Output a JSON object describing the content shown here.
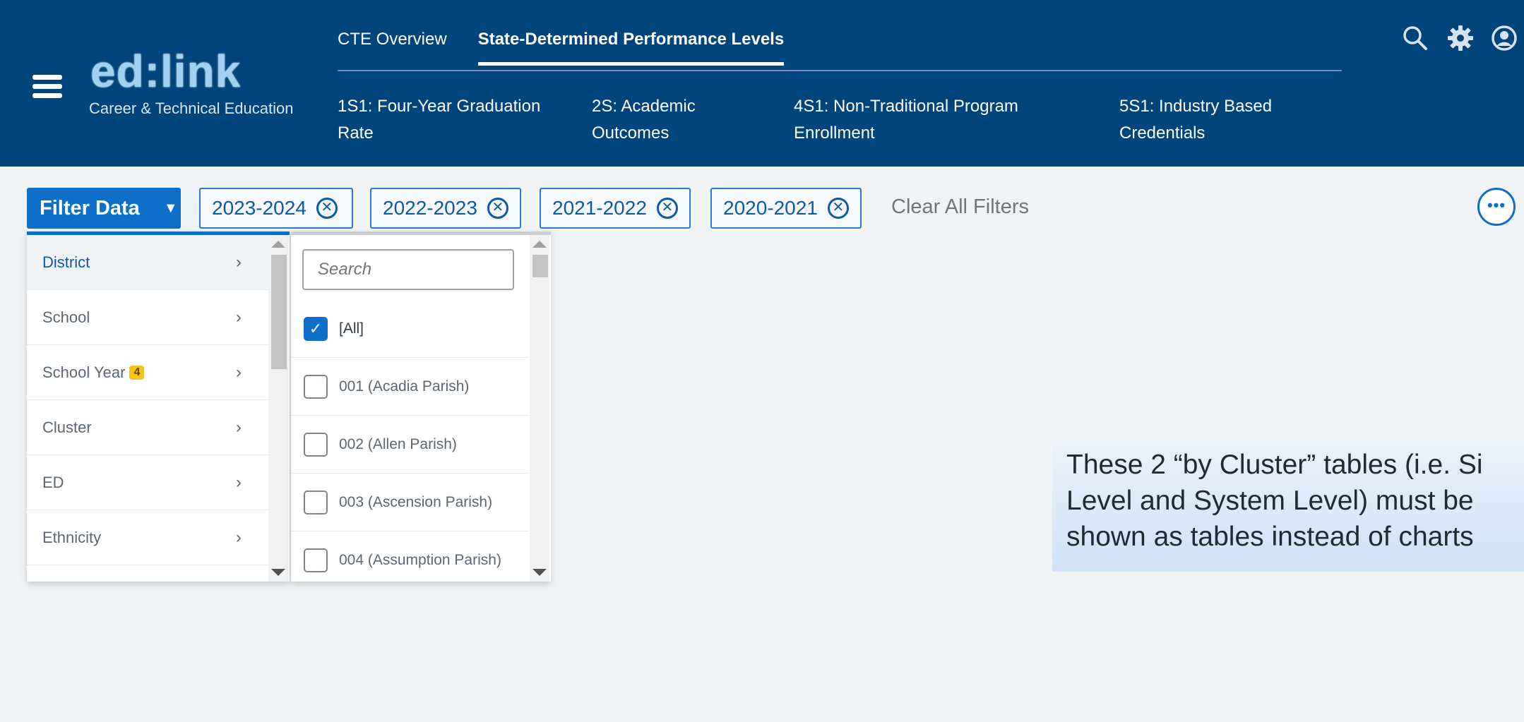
{
  "app": {
    "logo_text": "ed:link",
    "subtitle": "Career & Technical Education"
  },
  "nav": {
    "tabs": [
      {
        "label": "CTE Overview",
        "active": false
      },
      {
        "label": "State-Determined Performance Levels",
        "active": true
      }
    ],
    "subtabs": [
      {
        "line1": "1S1: Four-Year Graduation",
        "line2": "Rate"
      },
      {
        "line1": "2S: Academic",
        "line2": "Outcomes"
      },
      {
        "line1": "4S1: Non-Traditional Program",
        "line2": "Enrollment"
      },
      {
        "line1": "5S1: Industry Based",
        "line2": "Credentials"
      }
    ]
  },
  "header_icons": [
    "search-icon",
    "gear-icon",
    "account-icon"
  ],
  "toolbar": {
    "filter_label": "Filter Data",
    "chips": [
      "2023-2024",
      "2022-2023",
      "2021-2022",
      "2020-2021"
    ],
    "clear_label": "Clear All Filters",
    "more_label": "•••"
  },
  "filter_panel": {
    "categories": [
      {
        "label": "District",
        "active": true,
        "badge": null
      },
      {
        "label": "School",
        "active": false,
        "badge": null
      },
      {
        "label": "School Year",
        "active": false,
        "badge": "4"
      },
      {
        "label": "Cluster",
        "active": false,
        "badge": null
      },
      {
        "label": "ED",
        "active": false,
        "badge": null
      },
      {
        "label": "Ethnicity",
        "active": false,
        "badge": null
      }
    ],
    "search_placeholder": "Search",
    "options": [
      {
        "label": "[All]",
        "checked": true
      },
      {
        "label": "001 (Acadia Parish)",
        "checked": false
      },
      {
        "label": "002 (Allen Parish)",
        "checked": false
      },
      {
        "label": "003 (Ascension Parish)",
        "checked": false
      },
      {
        "label": "004 (Assumption Parish)",
        "checked": false
      }
    ]
  },
  "annotation": {
    "line1": "These 2 “by Cluster” tables (i.e. Si",
    "line2": "Level and System Level) must be",
    "line3": "shown as tables instead of charts"
  },
  "colors": {
    "header": "#00447c",
    "accent": "#0d6fc9",
    "badge": "#f5c518",
    "content_bg": "#eff3f5"
  }
}
